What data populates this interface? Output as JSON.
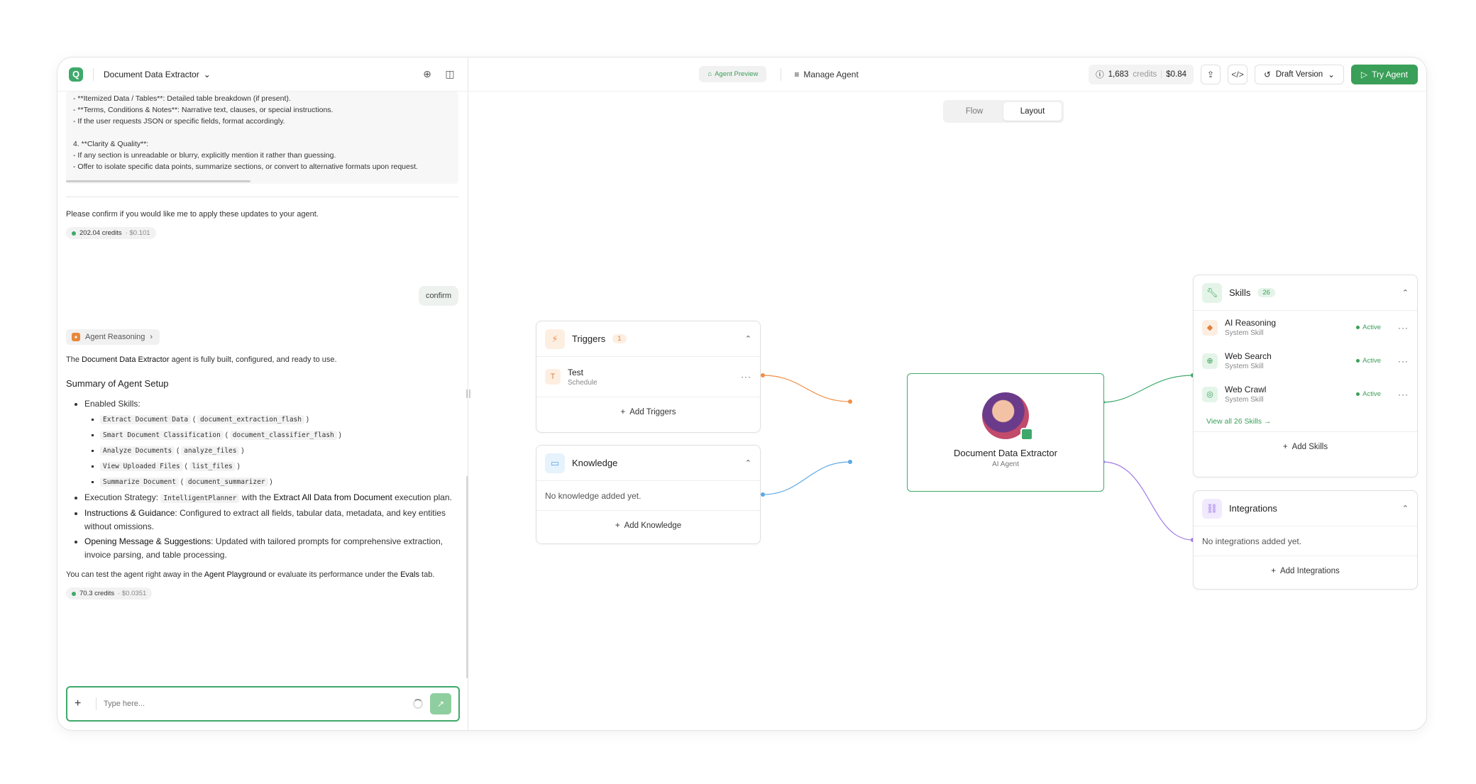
{
  "left": {
    "title": "Document Data Extractor",
    "code_lines": [
      "   - **Itemized Data / Tables**: Detailed table breakdown (if present).",
      "   - **Terms, Conditions & Notes**: Narrative text, clauses, or special instructions.",
      " - If the user requests JSON or specific fields, format accordingly.",
      "",
      "4. **Clarity & Quality**:",
      "   - If any section is unreadable or blurry, explicitly mention it rather than guessing.",
      "   - Offer to isolate specific data points, summarize sections, or convert to alternative formats upon request."
    ],
    "confirm_prompt": "Please confirm if you would like me to apply these updates to your agent.",
    "credit1": {
      "amount": "202.04 credits",
      "cost": "· $0.101"
    },
    "user_msg": "confirm",
    "reasoning_label": "Agent Reasoning",
    "ready_pre": "The ",
    "ready_bold": "Document Data Extractor",
    "ready_post": " agent is fully built, configured, and ready to use.",
    "summary_title": "Summary of Agent Setup",
    "enabled_skills_label": "Enabled Skills:",
    "skills": [
      {
        "name": "Extract Document Data",
        "id": "document_extraction_flash"
      },
      {
        "name": "Smart Document Classification",
        "id": "document_classifier_flash"
      },
      {
        "name": "Analyze Documents",
        "id": "analyze_files"
      },
      {
        "name": "View Uploaded Files",
        "id": "list_files"
      },
      {
        "name": "Summarize Document",
        "id": "document_summarizer"
      }
    ],
    "exec_label": "Execution Strategy:",
    "exec_code": "IntelligentPlanner",
    "exec_mid": " with the ",
    "exec_bold": "Extract All Data from Document",
    "exec_post": " execution plan.",
    "instr_label": "Instructions & Guidance",
    "instr_text": ": Configured to extract all fields, tabular data, metadata, and key entities without omissions.",
    "open_label": "Opening Message & Suggestions",
    "open_text": ": Updated with tailored prompts for comprehensive extraction, invoice parsing, and table processing.",
    "test_pre": "You can test the agent right away in the ",
    "test_b1": "Agent Playground",
    "test_mid": " or evaluate its performance under the ",
    "test_b2": "Evals",
    "test_post": " tab.",
    "credit2": {
      "amount": "70.3 credits",
      "cost": "· $0.0351"
    },
    "input_placeholder": "Type here..."
  },
  "header": {
    "agent_preview": "Agent Preview",
    "manage_agent": "Manage Agent",
    "credits": "1,683",
    "credits_unit": "credits",
    "cost": "$0.84",
    "draft": "Draft Version",
    "try": "Try Agent"
  },
  "toggle": {
    "flow": "Flow",
    "layout": "Layout"
  },
  "triggers": {
    "title": "Triggers",
    "count": "1",
    "item": {
      "letter": "T",
      "name": "Test",
      "type": "Schedule"
    },
    "add": "Add Triggers"
  },
  "knowledge": {
    "title": "Knowledge",
    "empty": "No knowledge added yet.",
    "add": "Add Knowledge"
  },
  "agent": {
    "name": "Document Data Extractor",
    "type": "AI Agent"
  },
  "skills_card": {
    "title": "Skills",
    "count": "26",
    "items": [
      {
        "name": "AI Reasoning",
        "type": "System Skill",
        "status": "Active"
      },
      {
        "name": "Web Search",
        "type": "System Skill",
        "status": "Active"
      },
      {
        "name": "Web Crawl",
        "type": "System Skill",
        "status": "Active"
      }
    ],
    "view_all": "View all 26 Skills →",
    "add": "Add Skills"
  },
  "integrations": {
    "title": "Integrations",
    "empty": "No integrations added yet.",
    "add": "Add Integrations"
  },
  "colors": {
    "accent": "#3fa96b",
    "trigger": "#f0904a",
    "knowledge": "#5aa9e6",
    "integration": "#a07ae6"
  }
}
